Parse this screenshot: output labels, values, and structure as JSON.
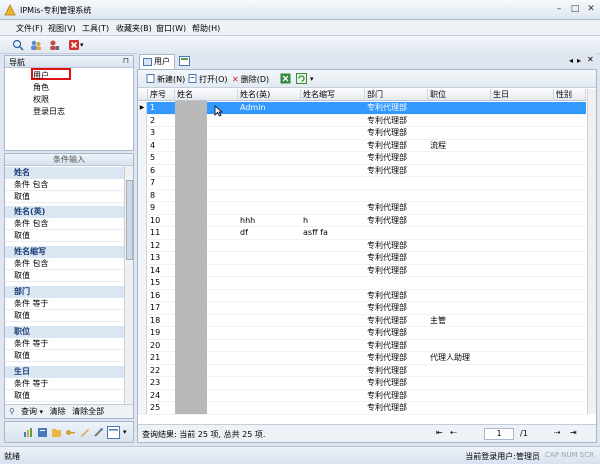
{
  "window": {
    "title": "IPMis-专利管理系统"
  },
  "menu": [
    "文件(F)",
    "视图(V)",
    "工具(T)",
    "收藏夹(B)",
    "窗口(W)",
    "帮助(H)"
  ],
  "nav": {
    "title": "导航",
    "items": [
      "用户",
      "角色",
      "权限",
      "登录日志"
    ]
  },
  "conditions": {
    "title": "条件输入",
    "groups": [
      {
        "name": "姓名",
        "rows": [
          "条件  包含",
          "取值"
        ]
      },
      {
        "name": "姓名(英)",
        "rows": [
          "条件  包含",
          "取值"
        ]
      },
      {
        "name": "姓名缩写",
        "rows": [
          "条件  包含",
          "取值"
        ]
      },
      {
        "name": "部门",
        "rows": [
          "条件  等于",
          "取值"
        ]
      },
      {
        "name": "职位",
        "rows": [
          "条件  等于",
          "取值"
        ]
      },
      {
        "name": "生日",
        "rows": [
          "条件  等于",
          "取值"
        ]
      }
    ],
    "footer": {
      "query": "查询",
      "clear": "清除",
      "clear_all": "清除全部"
    }
  },
  "tab": {
    "label": "用户"
  },
  "toolbar": {
    "new": "新建(N)",
    "open": "打开(O)",
    "delete": "删除(D)"
  },
  "grid": {
    "columns": [
      "序号",
      "姓名",
      "姓名(英)",
      "姓名缩写",
      "部门",
      "职位",
      "生日",
      "性别"
    ],
    "rows": [
      [
        "1",
        "",
        "Admin",
        "",
        "专利代理部",
        "",
        "",
        ""
      ],
      [
        "2",
        "",
        "",
        "",
        "专利代理部",
        "",
        "",
        ""
      ],
      [
        "3",
        "",
        "",
        "",
        "专利代理部",
        "",
        "",
        ""
      ],
      [
        "4",
        "",
        "",
        "",
        "专利代理部",
        "流程",
        "",
        ""
      ],
      [
        "5",
        "",
        "",
        "",
        "专利代理部",
        "",
        "",
        ""
      ],
      [
        "6",
        "",
        "",
        "",
        "专利代理部",
        "",
        "",
        ""
      ],
      [
        "7",
        "",
        "",
        "",
        "",
        "",
        "",
        ""
      ],
      [
        "8",
        "",
        "",
        "",
        "",
        "",
        "",
        ""
      ],
      [
        "9",
        "",
        "",
        "",
        "专利代理部",
        "",
        "",
        ""
      ],
      [
        "10",
        "",
        "hhh",
        "h",
        "专利代理部",
        "",
        "",
        ""
      ],
      [
        "11",
        "",
        "df",
        "asff fa",
        "",
        "",
        "",
        ""
      ],
      [
        "12",
        "",
        "",
        "",
        "专利代理部",
        "",
        "",
        ""
      ],
      [
        "13",
        "",
        "",
        "",
        "专利代理部",
        "",
        "",
        ""
      ],
      [
        "14",
        "",
        "",
        "",
        "专利代理部",
        "",
        "",
        ""
      ],
      [
        "15",
        "",
        "",
        "",
        "",
        "",
        "",
        ""
      ],
      [
        "16",
        "",
        "",
        "",
        "专利代理部",
        "",
        "",
        ""
      ],
      [
        "17",
        "",
        "",
        "",
        "专利代理部",
        "",
        "",
        ""
      ],
      [
        "18",
        "",
        "",
        "",
        "专利代理部",
        "主管",
        "",
        ""
      ],
      [
        "19",
        "",
        "",
        "",
        "专利代理部",
        "",
        "",
        ""
      ],
      [
        "20",
        "",
        "",
        "",
        "专利代理部",
        "",
        "",
        ""
      ],
      [
        "21",
        "",
        "",
        "",
        "专利代理部",
        "代理人助理",
        "",
        ""
      ],
      [
        "22",
        "",
        "",
        "",
        "专利代理部",
        "",
        "",
        ""
      ],
      [
        "23",
        "",
        "",
        "",
        "专利代理部",
        "",
        "",
        ""
      ],
      [
        "24",
        "",
        "",
        "",
        "专利代理部",
        "",
        "",
        ""
      ],
      [
        "25",
        "",
        "",
        "",
        "专利代理部",
        "",
        "",
        ""
      ]
    ]
  },
  "grid_status": {
    "text": "查询结果: 当前 25 项, 总共 25 项.",
    "page_current": "1",
    "page_total": "/1"
  },
  "statusbar": {
    "left": "就绪",
    "right": "当前登录用户:管理员",
    "keys": "CAP  NUM  SCR"
  },
  "colors": {
    "selection": "#3399ff",
    "header_bg": "#dbe6f3",
    "accent": "#1a3c78"
  }
}
